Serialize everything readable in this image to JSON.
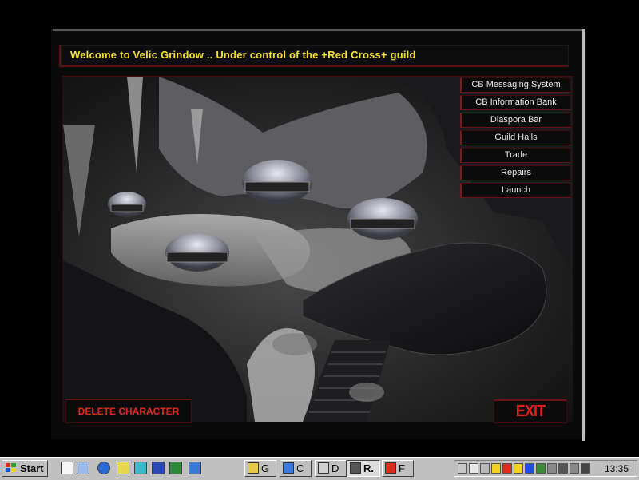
{
  "title": "Welcome to Velic Grindow .. Under control of the +Red Cross+ guild",
  "nav": [
    "CB Messaging System",
    "CB Information Bank",
    "Diaspora Bar",
    "Guild Halls",
    "Trade",
    "Repairs",
    "Launch"
  ],
  "delete_label": "DELETE CHARACTER",
  "exit_label": "EXIT",
  "colors": {
    "title": "#f2e035",
    "accent_red": "#e02014",
    "frame_red": "#6a1212"
  },
  "taskbar": {
    "start_label": "Start",
    "quick_launch": [
      "notepad-icon",
      "find-icon",
      "internet-explorer-icon",
      "app-icon",
      "app-icon",
      "word-icon",
      "excel-icon",
      "network-icon"
    ],
    "tasks": [
      {
        "label": "G",
        "icon": "folder-icon"
      },
      {
        "label": "C",
        "icon": "network-icon"
      },
      {
        "label": "D",
        "icon": "app-icon"
      },
      {
        "label": "R.",
        "icon": "app-icon"
      },
      {
        "label": "F",
        "icon": "app-icon"
      }
    ],
    "clock": "13:35"
  }
}
